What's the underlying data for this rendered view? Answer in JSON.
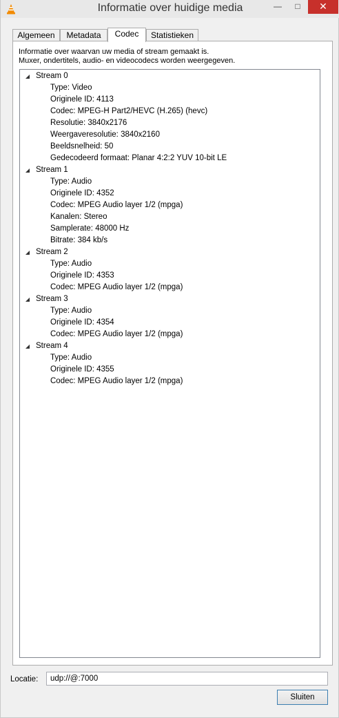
{
  "window": {
    "title": "Informatie over huidige media",
    "controls": {
      "minimize": "—",
      "maximize": "□",
      "close": "✕"
    },
    "accent_close": "#c7302b"
  },
  "tabs": [
    {
      "label": "Algemeen"
    },
    {
      "label": "Metadata"
    },
    {
      "label": "Codec",
      "active": true
    },
    {
      "label": "Statistieken"
    }
  ],
  "codec": {
    "intro_line1": "Informatie over waarvan uw media of stream gemaakt is.",
    "intro_line2": "Muxer, ondertitels, audio- en videocodecs worden weergegeven.",
    "streams": [
      {
        "name": "Stream 0",
        "props": [
          "Type: Video",
          "Originele ID: 4113",
          "Codec: MPEG-H Part2/HEVC (H.265) (hevc)",
          "Resolutie: 3840x2176",
          "Weergaveresolutie: 3840x2160",
          "Beeldsnelheid: 50",
          "Gedecodeerd formaat: Planar 4:2:2 YUV 10-bit LE"
        ]
      },
      {
        "name": "Stream 1",
        "props": [
          "Type: Audio",
          "Originele ID: 4352",
          "Codec: MPEG Audio layer 1/2 (mpga)",
          "Kanalen: Stereo",
          "Samplerate: 48000 Hz",
          "Bitrate: 384 kb/s"
        ]
      },
      {
        "name": "Stream 2",
        "props": [
          "Type: Audio",
          "Originele ID: 4353",
          "Codec: MPEG Audio layer 1/2 (mpga)"
        ]
      },
      {
        "name": "Stream 3",
        "props": [
          "Type: Audio",
          "Originele ID: 4354",
          "Codec: MPEG Audio layer 1/2 (mpga)"
        ]
      },
      {
        "name": "Stream 4",
        "props": [
          "Type: Audio",
          "Originele ID: 4355",
          "Codec: MPEG Audio layer 1/2 (mpga)"
        ]
      }
    ]
  },
  "location": {
    "label": "Locatie:",
    "value": "udp://@:7000"
  },
  "footer": {
    "close_label": "Sluiten"
  }
}
